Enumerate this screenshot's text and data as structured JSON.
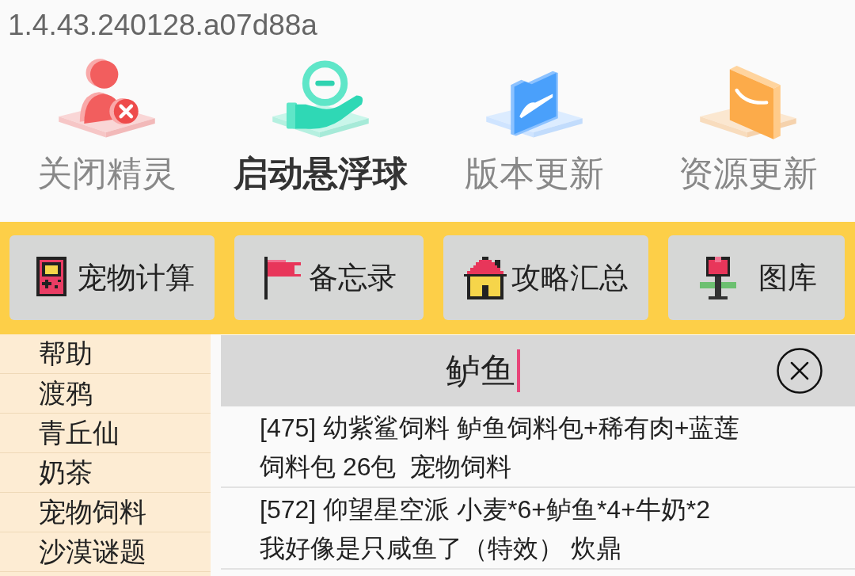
{
  "version": "1.4.43.240128.a07d88a",
  "actions": [
    {
      "label": "关闭精灵",
      "kind": "user-remove",
      "selected": false
    },
    {
      "label": "启动悬浮球",
      "kind": "hand-coin",
      "selected": true
    },
    {
      "label": "版本更新",
      "kind": "folder",
      "selected": false
    },
    {
      "label": "资源更新",
      "kind": "card",
      "selected": false
    }
  ],
  "toolbar": [
    {
      "label": "宠物计算",
      "kind": "game-console"
    },
    {
      "label": "备忘录",
      "kind": "flag"
    },
    {
      "label": "攻略汇总",
      "kind": "house"
    },
    {
      "label": "图库",
      "kind": "flower"
    }
  ],
  "sidebar": [
    "帮助",
    "渡鸦",
    "青丘仙",
    "奶茶",
    "宠物饲料",
    "沙漠谜题"
  ],
  "search": {
    "value": "鲈鱼",
    "focused": true
  },
  "results": [
    {
      "lines": [
        "[475] 幼紫鲨饲料 鲈鱼饲料包+稀有肉+蓝莲",
        "饲料包 26包  宠物饲料"
      ]
    },
    {
      "lines": [
        "[572] 仰望星空派 小麦*6+鲈鱼*4+牛奶*2",
        "我好像是只咸鱼了（特效） 炊鼎"
      ]
    }
  ]
}
